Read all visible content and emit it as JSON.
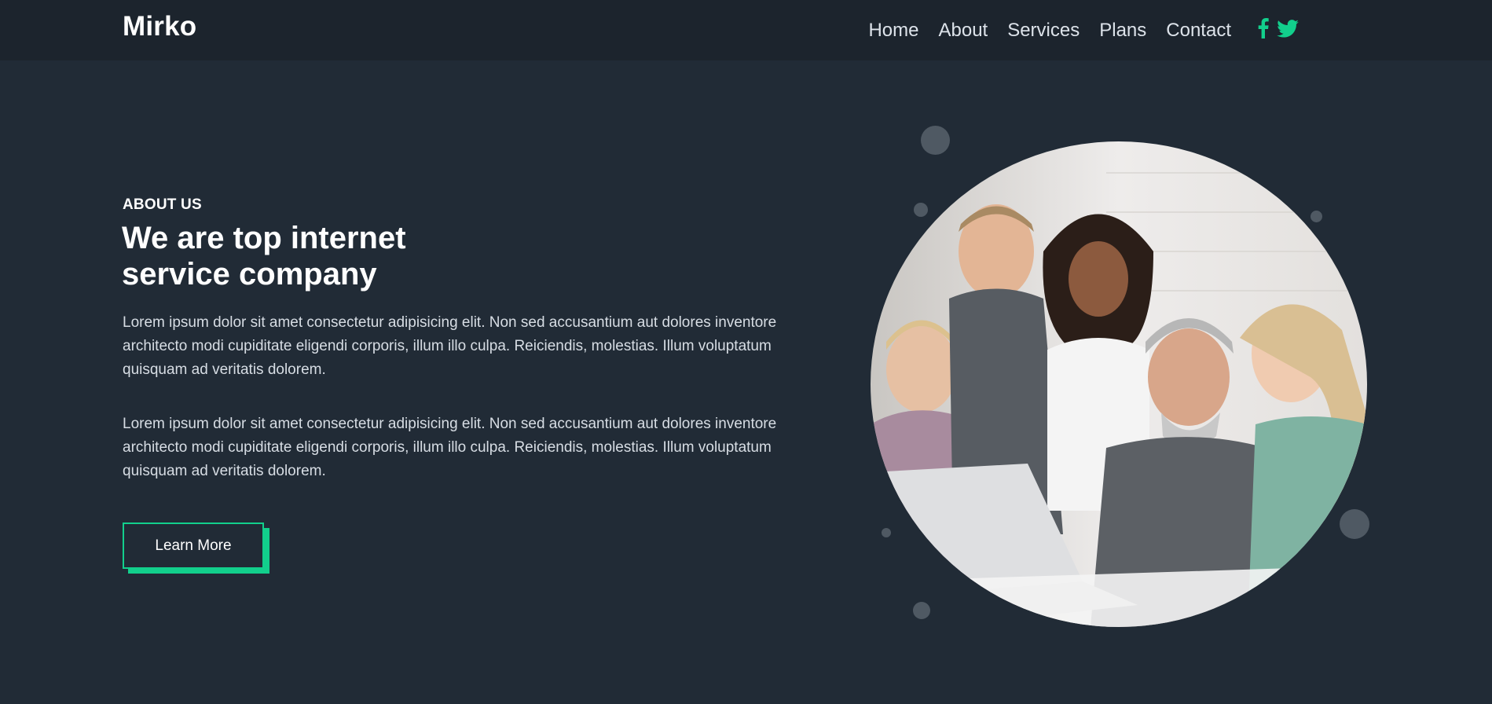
{
  "brand": {
    "name": "Mirko"
  },
  "nav": {
    "items": [
      {
        "label": "Home"
      },
      {
        "label": "About"
      },
      {
        "label": "Services"
      },
      {
        "label": "Plans"
      },
      {
        "label": "Contact"
      }
    ],
    "social": [
      {
        "icon": "facebook-icon"
      },
      {
        "icon": "twitter-icon"
      }
    ]
  },
  "hero": {
    "eyebrow": "ABOUT US",
    "title_line1": "We are top internet",
    "title_line2": "service company",
    "paragraphs": [
      "Lorem ipsum dolor sit amet consectetur adipisicing elit. Non sed accusantium aut dolores inventore architecto modi cupiditate eligendi corporis, illum illo culpa. Reiciendis, molestias. Illum voluptatum quisquam ad veritatis dolorem.",
      "Lorem ipsum dolor sit amet consectetur adipisicing elit. Non sed accusantium aut dolores inventore architecto modi cupiditate eligendi corporis, illum illo culpa. Reiciendis, molestias. Illum voluptatum quisquam ad veritatis dolorem."
    ],
    "cta_label": "Learn More"
  },
  "colors": {
    "background": "#212b36",
    "navbar": "#1c242d",
    "accent": "#12cf8c",
    "text": "#ffffff",
    "muted_text": "#d7dde4"
  }
}
